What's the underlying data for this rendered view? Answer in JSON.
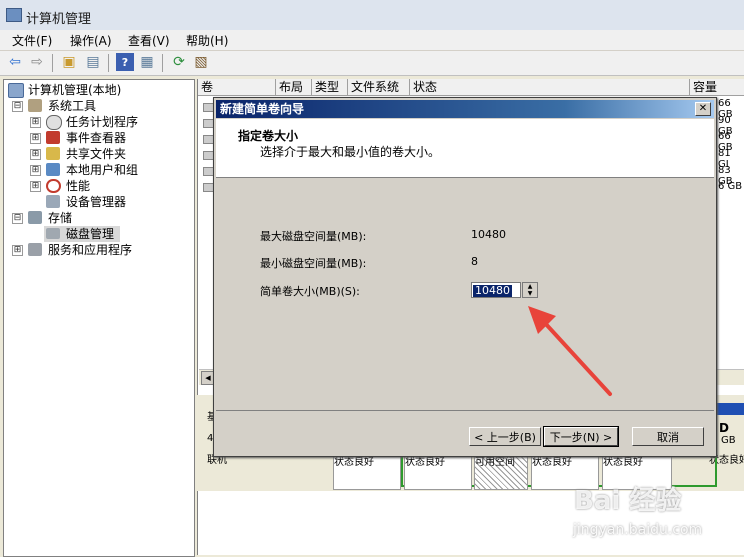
{
  "window": {
    "title": "计算机管理"
  },
  "menu": [
    "文件(F)",
    "操作(A)",
    "查看(V)",
    "帮助(H)"
  ],
  "tree": {
    "root": "计算机管理(本地)",
    "items": [
      {
        "label": "系统工具",
        "expander": "⊟"
      },
      {
        "label": "任务计划程序",
        "expander": "⊞"
      },
      {
        "label": "事件查看器",
        "expander": "⊞"
      },
      {
        "label": "共享文件夹",
        "expander": "⊞"
      },
      {
        "label": "本地用户和组",
        "expander": "⊞"
      },
      {
        "label": "性能",
        "expander": "⊞"
      },
      {
        "label": "设备管理器",
        "expander": ""
      },
      {
        "label": "存储",
        "expander": "⊟"
      },
      {
        "label": "磁盘管理",
        "expander": ""
      },
      {
        "label": "服务和应用程序",
        "expander": "⊞"
      }
    ]
  },
  "list": {
    "columns": [
      "卷",
      "布局",
      "类型",
      "文件系统",
      "状态",
      "容量"
    ],
    "capacities": [
      "66 GB",
      "90 GB",
      "66 GB",
      "81 GI",
      "83 GB",
      "6 GB"
    ]
  },
  "lower": {
    "left_labels": [
      "基",
      "40",
      "联机"
    ],
    "right_labels": [
      "D",
      "GB",
      "状态良好"
    ],
    "partitions": [
      "状态良好",
      "状态良好",
      "可用空间",
      "状态良好",
      "状态良好",
      "状态良好"
    ]
  },
  "wizard": {
    "title": "新建简单卷向导",
    "close": "✕",
    "header_title": "指定卷大小",
    "header_subtitle": "选择介于最大和最小值的卷大小。",
    "max_label": "最大磁盘空间量(MB):",
    "max_value": "10480",
    "min_label": "最小磁盘空间量(MB):",
    "min_value": "8",
    "size_label": "简单卷大小(MB)(S):",
    "size_value": "10480",
    "back_button": "< 上一步(B)",
    "next_button": "下一步(N) >",
    "cancel_button": "取消"
  },
  "watermark": {
    "brand": "Bai 经验",
    "url": "jingyan.baidu.com"
  },
  "colors": {
    "arrow": "#e8433a",
    "title_gradient_start": "#0a246a",
    "selection": "#0a246a"
  }
}
